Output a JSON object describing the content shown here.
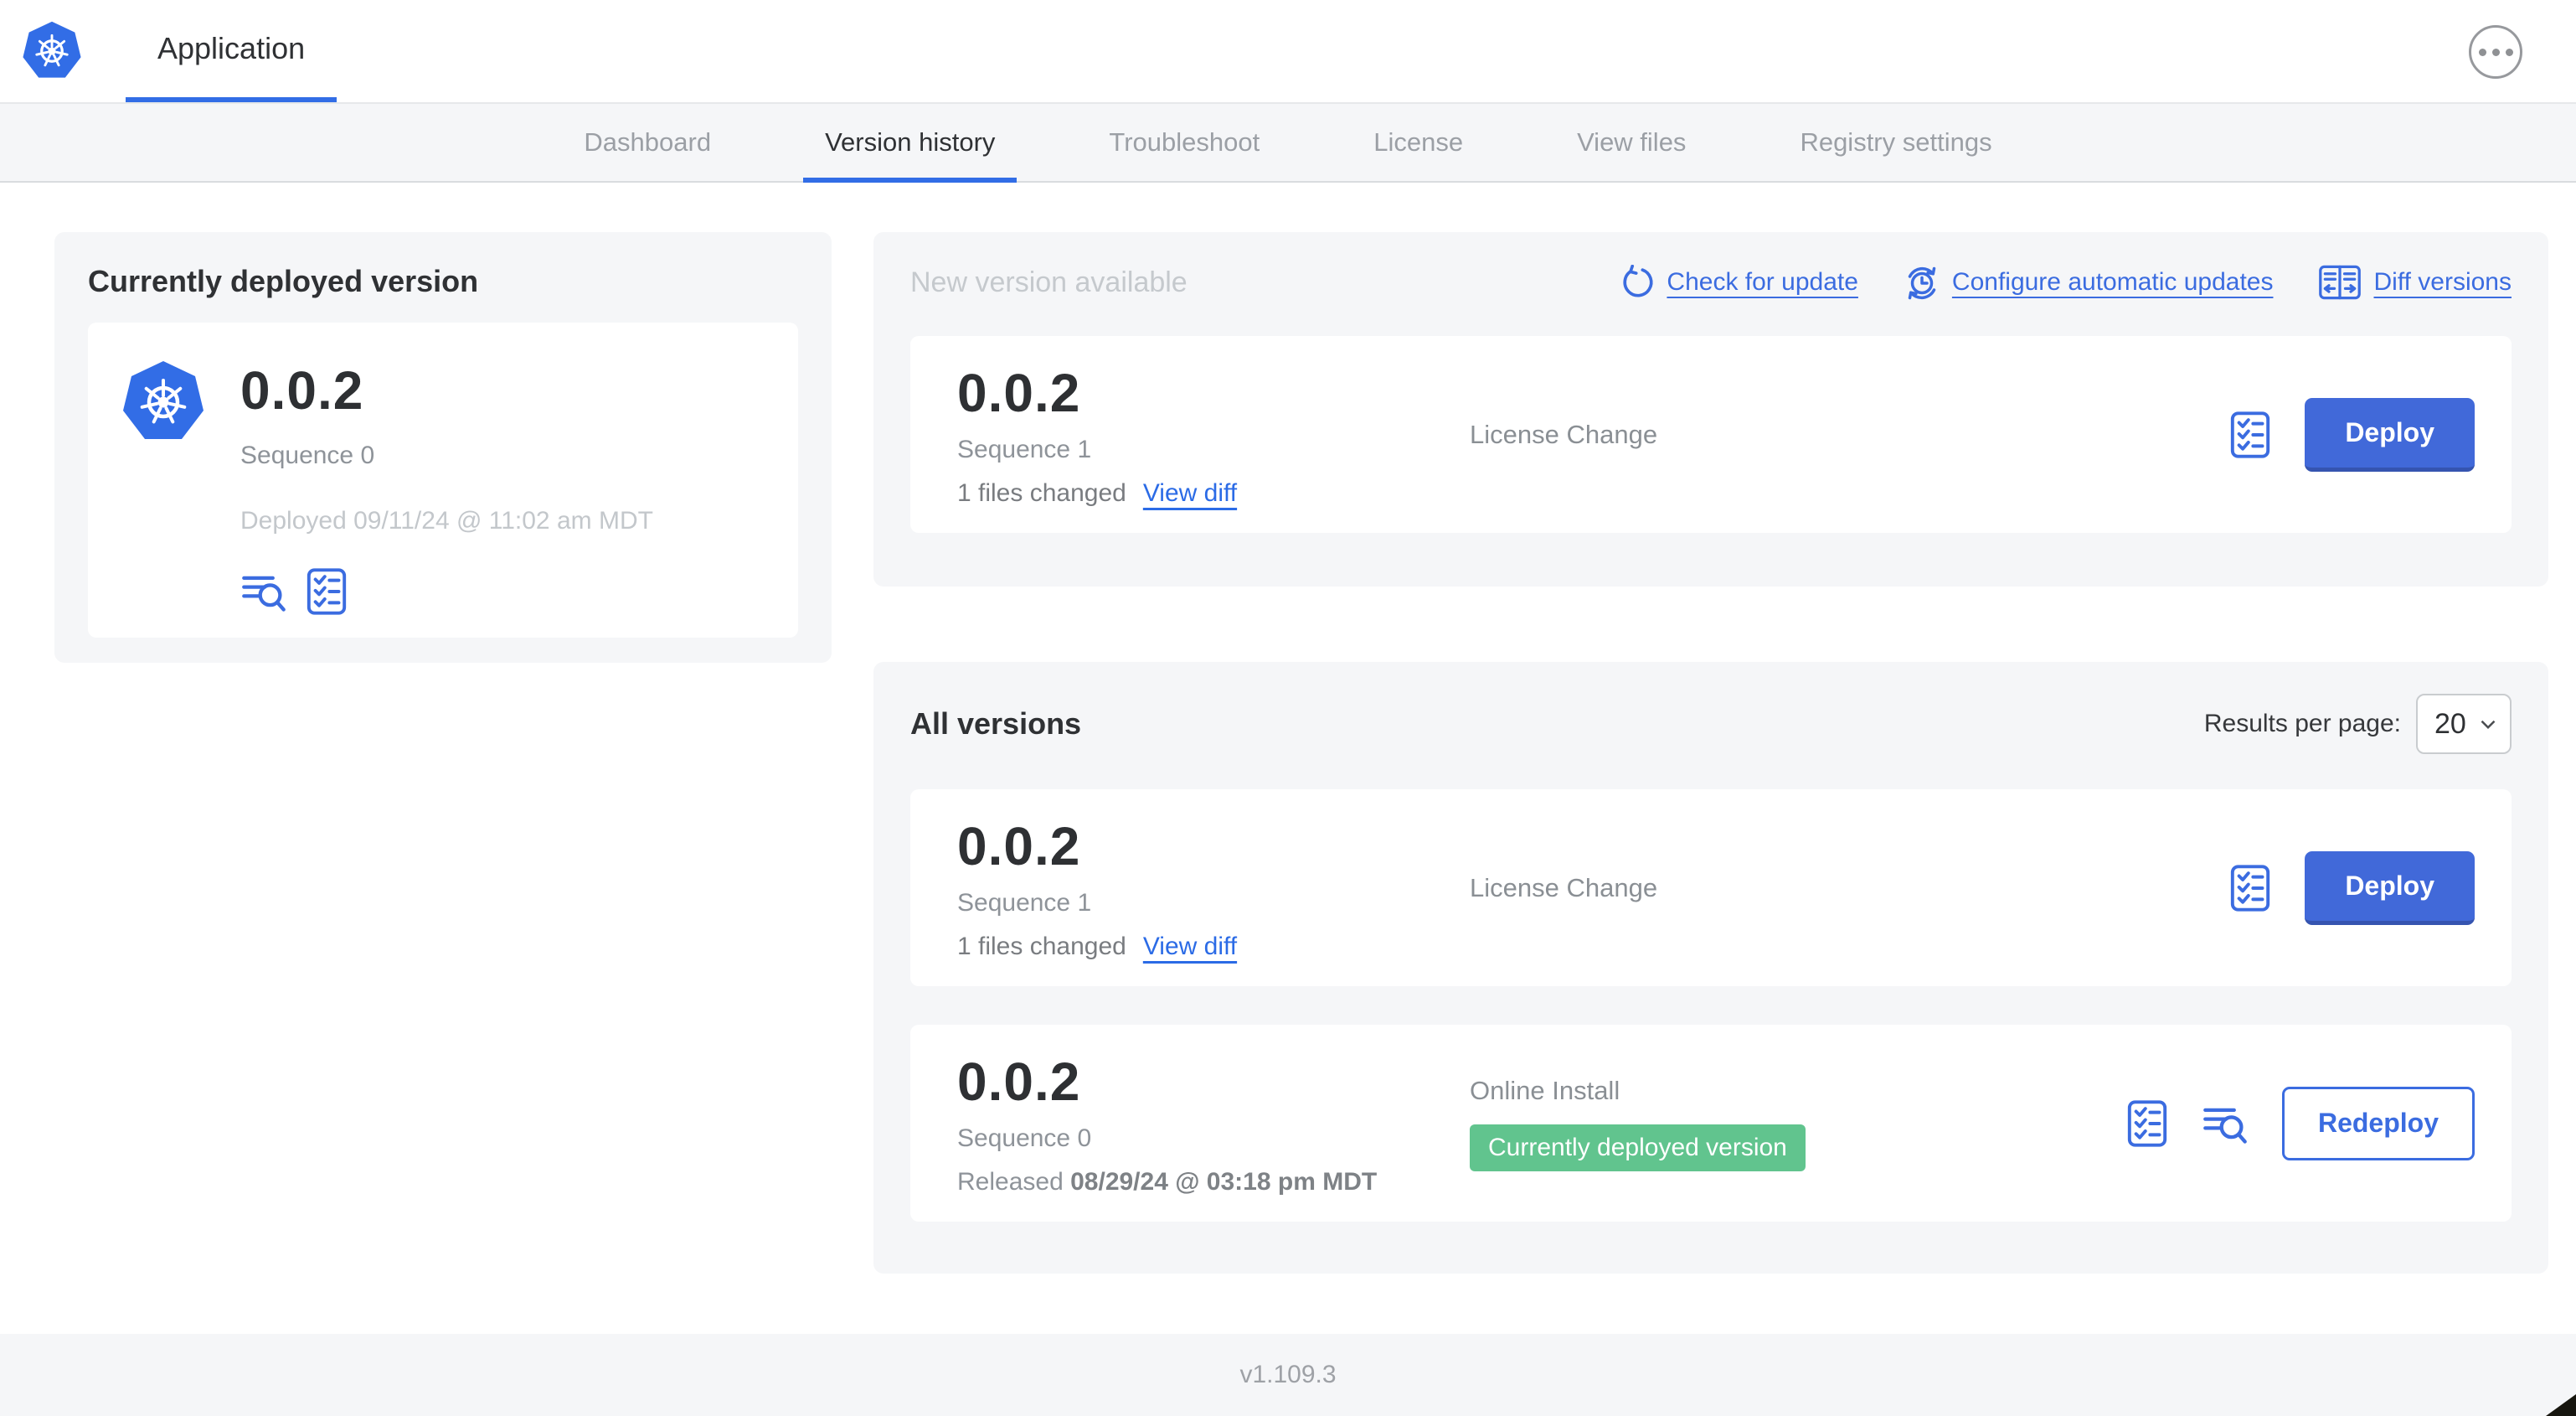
{
  "header": {
    "app_title": "Application"
  },
  "nav": {
    "tabs": [
      "Dashboard",
      "Version history",
      "Troubleshoot",
      "License",
      "View files",
      "Registry settings"
    ],
    "active_tab": "Version history"
  },
  "current_deployed": {
    "title": "Currently deployed version",
    "version": "0.0.2",
    "sequence": "Sequence 0",
    "deployed": "Deployed 09/11/24 @ 11:02 am MDT"
  },
  "new_version": {
    "title": "New version available",
    "check_for_update": "Check for update",
    "configure_automatic_updates": "Configure automatic updates",
    "diff_versions": "Diff versions",
    "card": {
      "version": "0.0.2",
      "sequence": "Sequence 1",
      "files_changed": "1 files changed",
      "view_diff": "View diff",
      "source": "License Change",
      "action_label": "Deploy"
    }
  },
  "all_versions": {
    "title": "All versions",
    "results_per_page_label": "Results per page:",
    "results_per_page_value": "20",
    "rows": [
      {
        "version": "0.0.2",
        "sequence": "Sequence 1",
        "files_changed": "1 files changed",
        "view_diff": "View diff",
        "source": "License Change",
        "action_label": "Deploy"
      },
      {
        "version": "0.0.2",
        "sequence": "Sequence 0",
        "released_prefix": "Released",
        "released_date": "08/29/24 @ 03:18 pm MDT",
        "source": "Online Install",
        "badge": "Currently deployed version",
        "action_label": "Redeploy"
      }
    ]
  },
  "footer": {
    "app_version": "v1.109.3"
  },
  "icons": {
    "logo": "kubernetes-logo",
    "menu": "ellipsis-icon",
    "check_update": "refresh-icon",
    "auto_updates": "schedule-refresh-icon",
    "diff": "diff-columns-icon",
    "logs": "deploy-logs-icon",
    "checklist": "preflight-checklist-icon",
    "select": "chevron-down-icon"
  },
  "colors": {
    "accent_blue": "#3B6CE0",
    "logo_blue": "#326DE6",
    "button_blue": "#4169D9",
    "badge_green": "#61C48E",
    "panel_gray": "#F5F6F8",
    "text_dark": "#2F3134",
    "text_gray": "#8E9399",
    "text_light": "#C5C9CD"
  }
}
